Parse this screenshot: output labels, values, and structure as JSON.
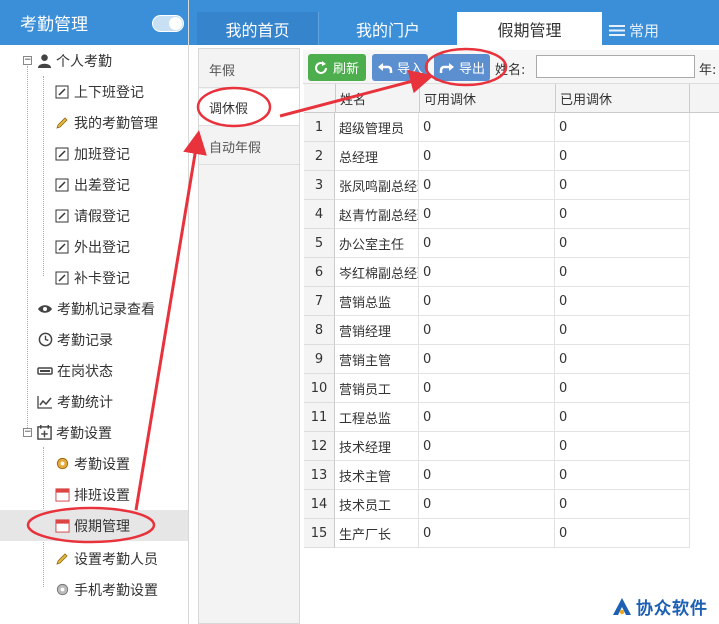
{
  "sidebar": {
    "title": "考勤管理",
    "items": [
      {
        "label": "个人考勤",
        "icon": "user-icon"
      },
      {
        "label": "上下班登记",
        "icon": "edit-icon"
      },
      {
        "label": "我的考勤管理",
        "icon": "pen-icon"
      },
      {
        "label": "加班登记",
        "icon": "edit-icon"
      },
      {
        "label": "出差登记",
        "icon": "edit-icon"
      },
      {
        "label": "请假登记",
        "icon": "edit-icon"
      },
      {
        "label": "外出登记",
        "icon": "edit-icon"
      },
      {
        "label": "补卡登记",
        "icon": "edit-icon"
      },
      {
        "label": "考勤机记录查看",
        "icon": "eye-icon"
      },
      {
        "label": "考勤记录",
        "icon": "clock-icon"
      },
      {
        "label": "在岗状态",
        "icon": "status-bar-icon"
      },
      {
        "label": "考勤统计",
        "icon": "line-chart-icon"
      },
      {
        "label": "考勤设置",
        "icon": "calendar-add-icon"
      },
      {
        "label": "考勤设置",
        "icon": "gear-icon"
      },
      {
        "label": "排班设置",
        "icon": "calendar-icon"
      },
      {
        "label": "假期管理",
        "icon": "calendar-icon"
      },
      {
        "label": "设置考勤人员",
        "icon": "pen-icon"
      },
      {
        "label": "手机考勤设置",
        "icon": "gear-icon"
      }
    ]
  },
  "tabs": {
    "home": "我的首页",
    "portal": "我的门户",
    "holiday": "假期管理",
    "common": "常用"
  },
  "subtabs": [
    "年假",
    "调休假",
    "自动年假"
  ],
  "toolbar": {
    "refresh": "刷新",
    "import": "导入",
    "export": "导出",
    "name_label": "姓名:",
    "year_label": "年:"
  },
  "table": {
    "columns": [
      "姓名",
      "可用调休",
      "已用调休"
    ],
    "rows": [
      {
        "n": "1",
        "name": "超级管理员",
        "avail": "0",
        "used": "0"
      },
      {
        "n": "2",
        "name": "总经理",
        "avail": "0",
        "used": "0"
      },
      {
        "n": "3",
        "name": "张凤鸣副总经理",
        "avail": "0",
        "used": "0"
      },
      {
        "n": "4",
        "name": "赵青竹副总经理",
        "avail": "0",
        "used": "0"
      },
      {
        "n": "5",
        "name": "办公室主任",
        "avail": "0",
        "used": "0"
      },
      {
        "n": "6",
        "name": "岑红棉副总经理",
        "avail": "0",
        "used": "0"
      },
      {
        "n": "7",
        "name": "营销总监",
        "avail": "0",
        "used": "0"
      },
      {
        "n": "8",
        "name": "营销经理",
        "avail": "0",
        "used": "0"
      },
      {
        "n": "9",
        "name": "营销主管",
        "avail": "0",
        "used": "0"
      },
      {
        "n": "10",
        "name": "营销员工",
        "avail": "0",
        "used": "0"
      },
      {
        "n": "11",
        "name": "工程总监",
        "avail": "0",
        "used": "0"
      },
      {
        "n": "12",
        "name": "技术经理",
        "avail": "0",
        "used": "0"
      },
      {
        "n": "13",
        "name": "技术主管",
        "avail": "0",
        "used": "0"
      },
      {
        "n": "14",
        "name": "技术员工",
        "avail": "0",
        "used": "0"
      },
      {
        "n": "15",
        "name": "生产厂长",
        "avail": "0",
        "used": "0"
      }
    ]
  },
  "logo": {
    "text": "协众软件"
  },
  "colors": {
    "brand": "#3a8fd8",
    "annotation": "#e8323c",
    "refresh_button": "#4cae4c",
    "action_button": "#5b8fd0"
  }
}
